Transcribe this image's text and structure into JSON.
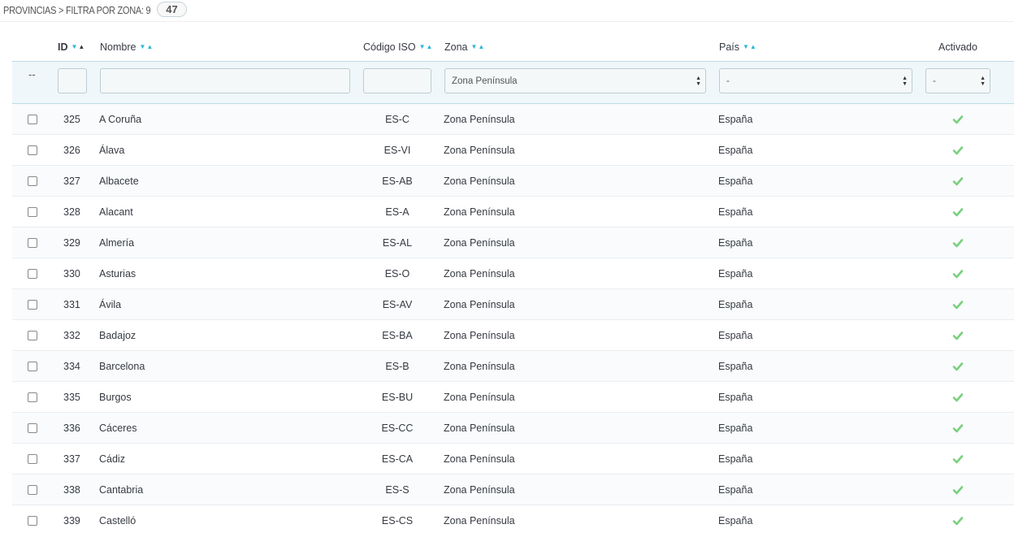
{
  "heading": {
    "title": "PROVINCIAS > FILTRA POR ZONA: 9",
    "count": "47"
  },
  "columns": {
    "id": "ID",
    "nombre": "Nombre",
    "codigo": "Código ISO",
    "zona": "Zona",
    "pais": "País",
    "activado": "Activado"
  },
  "filters": {
    "dash": "--",
    "zona_selected": "Zona Península",
    "pais_selected": "-",
    "activado_selected": "-"
  },
  "colors": {
    "accent": "#25b9d7",
    "check": "#78d07d"
  },
  "rows": [
    {
      "id": "325",
      "nombre": "A Coruña",
      "codigo": "ES-C",
      "zona": "Zona Península",
      "pais": "España",
      "activado": true
    },
    {
      "id": "326",
      "nombre": "Álava",
      "codigo": "ES-VI",
      "zona": "Zona Península",
      "pais": "España",
      "activado": true
    },
    {
      "id": "327",
      "nombre": "Albacete",
      "codigo": "ES-AB",
      "zona": "Zona Península",
      "pais": "España",
      "activado": true
    },
    {
      "id": "328",
      "nombre": "Alacant",
      "codigo": "ES-A",
      "zona": "Zona Península",
      "pais": "España",
      "activado": true
    },
    {
      "id": "329",
      "nombre": "Almería",
      "codigo": "ES-AL",
      "zona": "Zona Península",
      "pais": "España",
      "activado": true
    },
    {
      "id": "330",
      "nombre": "Asturias",
      "codigo": "ES-O",
      "zona": "Zona Península",
      "pais": "España",
      "activado": true
    },
    {
      "id": "331",
      "nombre": "Ávila",
      "codigo": "ES-AV",
      "zona": "Zona Península",
      "pais": "España",
      "activado": true
    },
    {
      "id": "332",
      "nombre": "Badajoz",
      "codigo": "ES-BA",
      "zona": "Zona Península",
      "pais": "España",
      "activado": true
    },
    {
      "id": "334",
      "nombre": "Barcelona",
      "codigo": "ES-B",
      "zona": "Zona Península",
      "pais": "España",
      "activado": true
    },
    {
      "id": "335",
      "nombre": "Burgos",
      "codigo": "ES-BU",
      "zona": "Zona Península",
      "pais": "España",
      "activado": true
    },
    {
      "id": "336",
      "nombre": "Cáceres",
      "codigo": "ES-CC",
      "zona": "Zona Península",
      "pais": "España",
      "activado": true
    },
    {
      "id": "337",
      "nombre": "Cádiz",
      "codigo": "ES-CA",
      "zona": "Zona Península",
      "pais": "España",
      "activado": true
    },
    {
      "id": "338",
      "nombre": "Cantabria",
      "codigo": "ES-S",
      "zona": "Zona Península",
      "pais": "España",
      "activado": true
    },
    {
      "id": "339",
      "nombre": "Castelló",
      "codigo": "ES-CS",
      "zona": "Zona Península",
      "pais": "España",
      "activado": true
    }
  ]
}
